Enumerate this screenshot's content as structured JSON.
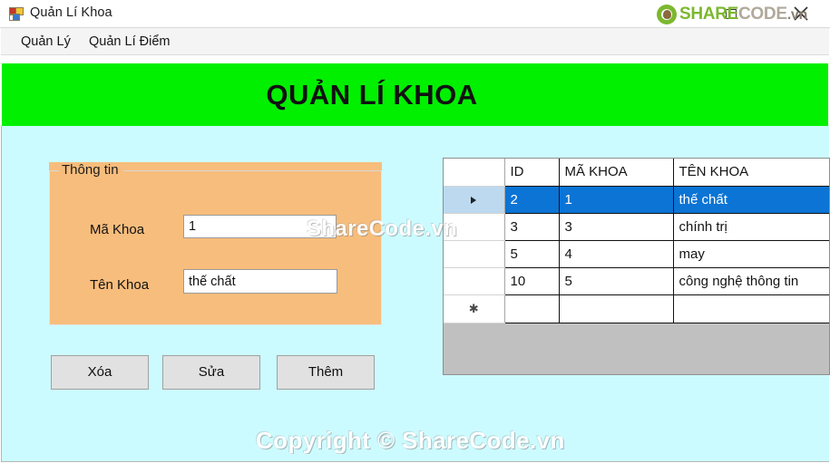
{
  "window": {
    "title": "Quản Lí Khoa",
    "icon": "vb-form-icon",
    "controls": {
      "maximize": "maximize-icon",
      "close": "close-icon"
    }
  },
  "brand_watermark": {
    "logo_icon": "sharecode-leaf-logo-icon",
    "part_a": "SHARE",
    "part_b": "CODE",
    "part_c": ".vn"
  },
  "menu": {
    "items": [
      {
        "label": "Quản Lý"
      },
      {
        "label": "Quản Lí Điểm"
      }
    ]
  },
  "banner": {
    "title": "QUẢN LÍ KHOA",
    "background_color": "#00F000",
    "text_color": "#111111"
  },
  "client": {
    "background_color": "#CCFBFF"
  },
  "groupbox": {
    "legend": "Thông tin",
    "background_color": "#F7BD7C",
    "fields": [
      {
        "label": "Mã Khoa",
        "value": "1",
        "placeholder": ""
      },
      {
        "label": "Tên Khoa",
        "value": "thế chất",
        "placeholder": ""
      }
    ]
  },
  "buttons": [
    {
      "label": "Xóa"
    },
    {
      "label": "Sửa"
    },
    {
      "label": "Thêm"
    }
  ],
  "grid": {
    "columns": [
      "",
      "ID",
      "MÃ KHOA",
      "TÊN KHOA"
    ],
    "selection_color": "#0B74D4",
    "rows": [
      {
        "marker": "arrow",
        "id": "2",
        "ma_khoa": "1",
        "ten_khoa": "thế chất",
        "selected": true
      },
      {
        "marker": "",
        "id": "3",
        "ma_khoa": "3",
        "ten_khoa": "chính trị",
        "selected": false
      },
      {
        "marker": "",
        "id": "5",
        "ma_khoa": "4",
        "ten_khoa": "may",
        "selected": false
      },
      {
        "marker": "",
        "id": "10",
        "ma_khoa": "5",
        "ten_khoa": "công nghệ thông tin",
        "selected": false
      },
      {
        "marker": "new",
        "id": "",
        "ma_khoa": "",
        "ten_khoa": "",
        "selected": false
      }
    ]
  },
  "watermarks": {
    "middle": "ShareCode.vn",
    "bottom": "Copyright © ShareCode.vn"
  }
}
